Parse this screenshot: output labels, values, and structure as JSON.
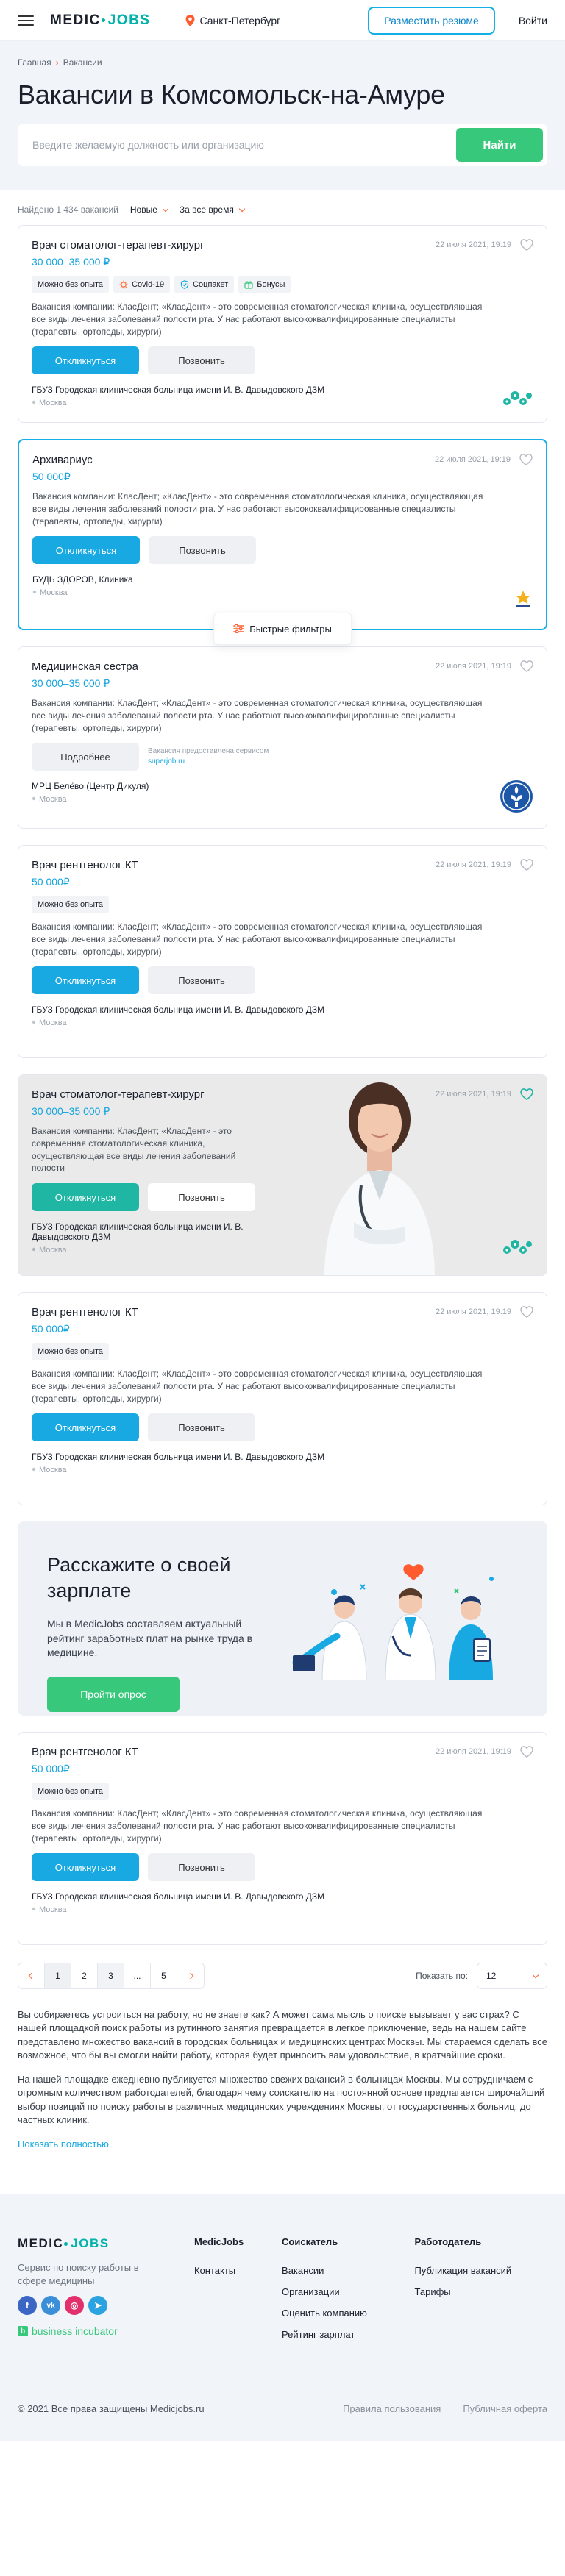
{
  "header": {
    "logo_a": "MEDIC",
    "logo_b": "JOBS",
    "city": "Санкт-Петербург",
    "post_resume": "Разместить резюме",
    "login": "Войти"
  },
  "hero": {
    "breadcrumb": [
      "Главная",
      "Вакансии"
    ],
    "title": "Вакансии в Комсомольск-на-Амуре",
    "search_placeholder": "Введите желаемую должность или организацию",
    "search_button": "Найти"
  },
  "filters": {
    "count": "Найдено 1 434 вакансий",
    "sort": "Новые",
    "period": "За все время"
  },
  "common": {
    "apply": "Откликнуться",
    "call": "Позвонить",
    "more": "Подробнее",
    "quick_filters": "Быстрые фильтры"
  },
  "cards": [
    {
      "title": "Врач стоматолог-терапевт-хирург",
      "date": "22 июля 2021, 19:19",
      "salary": "30 000–35 000 ₽",
      "tags": [
        "Можно без опыта",
        "Covid-19",
        "Соцпакет",
        "Бонусы"
      ],
      "desc": "Вакансия компании: КласДент; «КласДент» - это современная стоматологическая клиника, осуществляющая все виды лечения заболеваний полости рта. У нас работают высококвалифицированные специалисты (терапевты, ортопеды, хирурги)",
      "company": "ГБУЗ Городская клиническая больница имени И. В. Давыдовского ДЗМ",
      "city": "Москва"
    },
    {
      "title": "Архивариус",
      "date": "22 июля 2021, 19:19",
      "salary": "50 000₽",
      "desc": "Вакансия компании: КласДент; «КласДент» - это современная стоматологическая клиника, осуществляющая все виды лечения заболеваний полости рта. У нас работают высококвалифицированные специалисты (терапевты, ортопеды, хирурги)",
      "company": "БУДЬ ЗДОРОВ, Клиника",
      "city": "Москва"
    },
    {
      "title": "Медицинская сестра",
      "date": "22 июля 2021, 19:19",
      "salary": "30 000–35 000 ₽",
      "desc": "Вакансия компании: КласДент; «КласДент» - это современная стоматологическая клиника, осуществляющая все виды лечения заболеваний полости рта. У нас работают высококвалифицированные специалисты (терапевты, ортопеды, хирурги)",
      "source_label": "Вакансия предоставлена сервисом",
      "source_name": "superjob.ru",
      "company": "МРЦ Белёво (Центр Дикуля)",
      "city": "Москва"
    },
    {
      "title": "Врач рентгенолог КТ",
      "date": "22 июля 2021, 19:19",
      "salary": "50 000₽",
      "tags": [
        "Можно без опыта"
      ],
      "desc": "Вакансия компании: КласДент; «КласДент» - это современная стоматологическая клиника, осуществляющая все виды лечения заболеваний полости рта. У нас работают высококвалифицированные специалисты (терапевты, ортопеды, хирурги)",
      "company": "ГБУЗ Городская клиническая больница имени И. В. Давыдовского ДЗМ",
      "city": "Москва"
    },
    {
      "title": "Врач стоматолог-терапевт-хирург",
      "date": "22 июля 2021, 19:19",
      "salary": "30 000–35 000 ₽",
      "desc": "Вакансия компании: КласДент; «КласДент» - это современная стоматологическая клиника, осуществляющая все виды лечения заболеваний полости",
      "company": "ГБУЗ Городская клиническая больница имени И. В. Давыдовского ДЗМ",
      "city": "Москва"
    },
    {
      "title": "Врач рентгенолог КТ",
      "date": "22 июля 2021, 19:19",
      "salary": "50 000₽",
      "tags": [
        "Можно без опыта"
      ],
      "desc": "Вакансия компании: КласДент; «КласДент» - это современная стоматологическая клиника, осуществляющая все виды лечения заболеваний полости рта. У нас работают высококвалифицированные специалисты (терапевты, ортопеды, хирурги)",
      "company": "ГБУЗ Городская клиническая больница имени И. В. Давыдовского ДЗМ",
      "city": "Москва"
    },
    {
      "title": "Врач рентгенолог КТ",
      "date": "22 июля 2021, 19:19",
      "salary": "50 000₽",
      "tags": [
        "Можно без опыта"
      ],
      "desc": "Вакансия компании: КласДент; «КласДент» - это современная стоматологическая клиника, осуществляющая все виды лечения заболеваний полости рта. У нас работают высококвалифицированные специалисты (терапевты, ортопеды, хирурги)",
      "company": "ГБУЗ Городская клиническая больница имени И. В. Давыдовского ДЗМ",
      "city": "Москва"
    }
  ],
  "salary_banner": {
    "title": "Расскажите о своей зарплате",
    "desc": "Мы в MedicJobs составляем актуальный рейтинг заработных плат на рынке труда в медицине.",
    "button": "Пройти опрос"
  },
  "pagination": {
    "pages": [
      "1",
      "2",
      "3",
      "...",
      "5"
    ],
    "current": "1",
    "per_page_label": "Показать по:",
    "per_page_value": "12"
  },
  "seo": {
    "p1": "Вы собираетесь устроиться на работу, но не знаете как? А может сама мысль о поиске вызывает у вас страх? С нашей площадкой поиск работы из рутинного занятия превращается в легкое приключение, ведь на нашем сайте представлено множество вакансий в городских больницах и медицинских центрах Москвы. Мы стараемся сделать все возможное, что бы вы смогли найти работу, которая будет приносить вам удовольствие, в кратчайшие сроки.",
    "p2": "На нашей площадке ежедневно публикуется множество свежих вакансий в больницах Москвы. Мы сотрудничаем с огромным количеством работодателей, благодаря чему соискателю на постоянной основе предлагается широчайший выбор позиций по поиску работы в различных медицинских учреждениях Москвы, от государственных больниц, до частных клиник.",
    "show_all": "Показать полностью"
  },
  "footer": {
    "tagline": "Сервис по поиску работы в сфере медицины",
    "business": "business incubator",
    "col1": {
      "title": "MedicJobs",
      "links": [
        "Контакты"
      ]
    },
    "col2": {
      "title": "Соискатель",
      "links": [
        "Вакансии",
        "Организации",
        "Оценить компанию",
        "Рейтинг зарплат"
      ]
    },
    "col3": {
      "title": "Работодатель",
      "links": [
        "Публикация вакансий",
        "Тарифы"
      ]
    },
    "copyright": "© 2021 Все права защищены Medicjobs.ru",
    "terms": "Правила пользования",
    "offer": "Публичная оферта"
  },
  "colors": {
    "accent": "#18a9e3",
    "green": "#38c87b",
    "orange": "#ff5b2e",
    "teal": "#00b2a9"
  }
}
